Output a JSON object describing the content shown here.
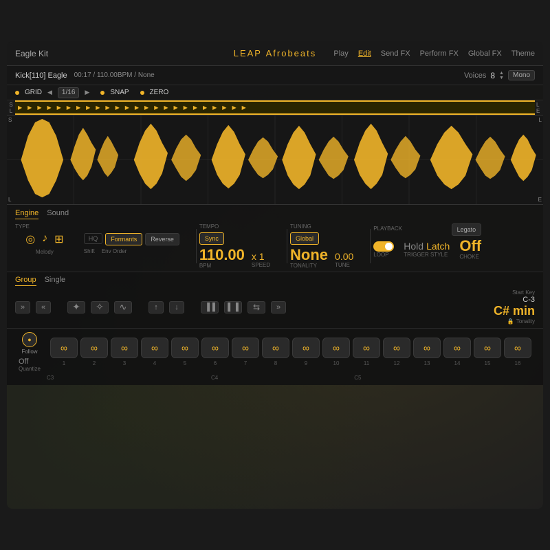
{
  "app": {
    "kit_name": "Eagle Kit",
    "title_leap": "LEAP",
    "title_style": "Afrobeats",
    "nav": {
      "play": "Play",
      "edit": "Edit",
      "send_fx": "Send FX",
      "perform_fx": "Perform FX",
      "global_fx": "Global FX",
      "theme": "Theme",
      "active": "Edit"
    }
  },
  "track": {
    "name": "Kick[110] Eagle",
    "time": "00:17 / 110.00BPM / None",
    "voices_label": "Voices",
    "voices_num": "8",
    "mono": "Mono"
  },
  "grid": {
    "grid_label": "GRID",
    "grid_value": "1/16",
    "snap_label": "SNAP",
    "zero_label": "ZERO",
    "grid_dot_color": "#f0b429",
    "snap_dot_color": "#f0b429",
    "zero_dot_color": "#f0b429"
  },
  "engine": {
    "tab_engine": "Engine",
    "tab_sound": "Sound",
    "type_label": "TYPE",
    "hq": "HQ",
    "formants": "Formants",
    "reverse": "Reverse",
    "tempo_label": "TEMPO",
    "sync_btn": "Sync",
    "tuning_label": "TUNING",
    "global_btn": "Global",
    "playback_label": "PLAYBACK",
    "legato_btn": "Legato",
    "bpm_value": "110.00",
    "bpm_label": "BPM",
    "speed_value": "x 1",
    "speed_label": "Speed",
    "tonality_value": "None",
    "tonality_label": "Tonality",
    "tune_value": "0.00",
    "tune_label": "Tune",
    "loop_label": "Loop",
    "hold_label": "Hold",
    "latch_label": "Latch",
    "trigger_style_label": "Trigger Style",
    "choke_value": "Off",
    "choke_label": "Choke",
    "type_icons": {
      "circle_label": "",
      "note_label": "Melody",
      "grid_label": "",
      "shift_label": "Shift",
      "env_label": "Env Order"
    }
  },
  "group": {
    "tab_group": "Group",
    "tab_single": "Single",
    "btn_ff": "»",
    "btn_rw": "«",
    "btn_shuffle1": "⧉",
    "btn_shuffle2": "⧈",
    "btn_wave": "∿",
    "btn_up": "↑",
    "btn_down": "↓",
    "btn_pause1": "▐▐",
    "btn_pause2": "▌▐",
    "btn_arrows": "⇆",
    "btn_ff2": "»",
    "start_key_label": "Start Key",
    "start_key_value": "C-3",
    "tonality_value": "C# min",
    "tonality_label": "Tonality",
    "lock_icon": "🔒"
  },
  "pads": {
    "follow_label": "Follow",
    "quantize_value": "Off",
    "quantize_label": "Quantize",
    "items": [
      {
        "num": "1",
        "note": "",
        "symbol": "∞"
      },
      {
        "num": "2",
        "note": "",
        "symbol": "∞"
      },
      {
        "num": "3",
        "note": "",
        "symbol": "∞"
      },
      {
        "num": "4",
        "note": "",
        "symbol": "∞"
      },
      {
        "num": "5",
        "note": "",
        "symbol": "∞"
      },
      {
        "num": "6",
        "note": "",
        "symbol": "∞"
      },
      {
        "num": "7",
        "note": "",
        "symbol": "∞"
      },
      {
        "num": "8",
        "note": "",
        "symbol": "∞"
      },
      {
        "num": "9",
        "note": "",
        "symbol": "∞"
      },
      {
        "num": "10",
        "note": "",
        "symbol": "∞"
      },
      {
        "num": "11",
        "note": "",
        "symbol": "∞"
      },
      {
        "num": "12",
        "note": "",
        "symbol": "∞"
      },
      {
        "num": "13",
        "note": "",
        "symbol": "∞"
      },
      {
        "num": "14",
        "note": "",
        "symbol": "∞"
      },
      {
        "num": "15",
        "note": "",
        "symbol": "∞"
      },
      {
        "num": "16",
        "note": "",
        "symbol": "∞"
      }
    ],
    "c3_label": "C3",
    "c4_label": "C4",
    "c5_label": "C5"
  },
  "colors": {
    "accent": "#f0b429",
    "bg_dark": "#1a1a1a",
    "bg_mid": "#1e1e1e",
    "text_dim": "#888888"
  }
}
